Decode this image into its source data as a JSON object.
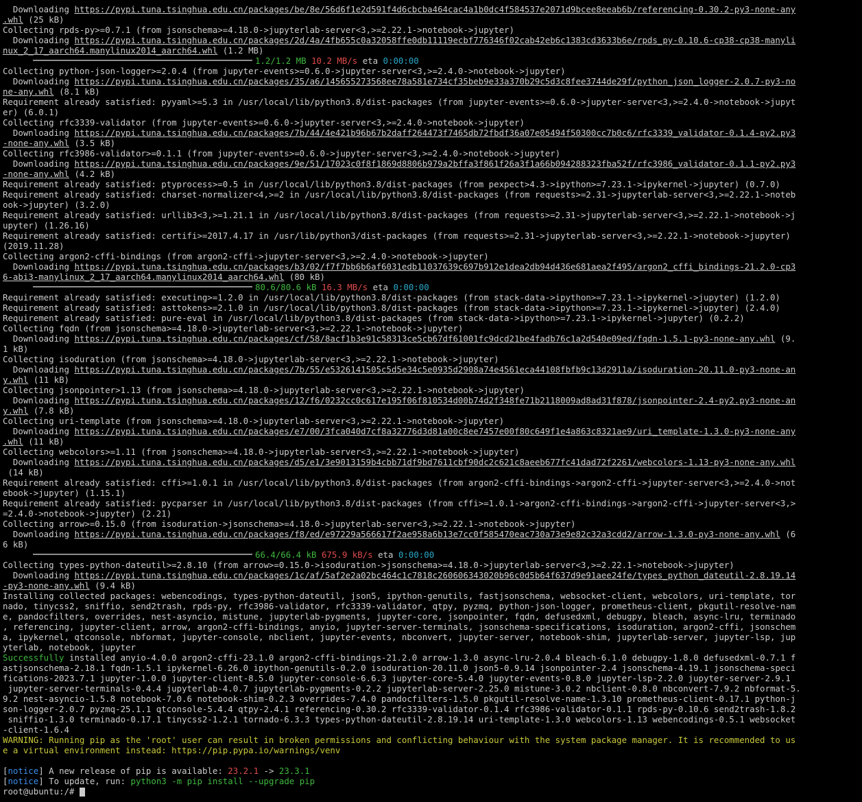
{
  "terminal": {
    "lines": [
      {
        "type": "dl",
        "pre": "  Downloading ",
        "url": "https://pypi.tuna.tsinghua.edu.cn/packages/be/8e/56d6f1e2d591f4d6cbcba464cac4a1b0dc4f584537e2071d9bcee8eeab6b/referencing-0.30.2-py3-none-any",
        "url2": ".whl",
        "post": " (25 kB)"
      },
      {
        "type": "plain",
        "text": "Collecting rpds-py>=0.7.1 (from jsonschema>=4.18.0->jupyterlab-server<3,>=2.22.1->notebook->jupyter)"
      },
      {
        "type": "dl",
        "pre": "  Downloading ",
        "url": "https://pypi.tuna.tsinghua.edu.cn/packages/2d/4a/4fb655c0a32058ffe0db11119ecbf776346f02cab42eb6c1383cd3633b6e/rpds_py-0.10.6-cp38-cp38-manyli",
        "url2": "nux_2_17_aarch64.manylinux2014_aarch64.whl",
        "post": " (1.2 MB)"
      },
      {
        "type": "prog",
        "done": "1.2/1.2 MB",
        "speed": "10.2 MB/s",
        "eta_label": "eta",
        "eta": "0:00:00"
      },
      {
        "type": "plain",
        "text": "Collecting python-json-logger>=2.0.4 (from jupyter-events>=0.6.0->jupyter-server<3,>=2.4.0->notebook->jupyter)"
      },
      {
        "type": "dl",
        "pre": "  Downloading ",
        "url": "https://pypi.tuna.tsinghua.edu.cn/packages/35/a6/145655273568ee78a581e734cf35beb9e33a370b29c5d3c8fee3744de29f/python_json_logger-2.0.7-py3-no",
        "url2": "ne-any.whl",
        "post": " (8.1 kB)"
      },
      {
        "type": "plain",
        "text": "Requirement already satisfied: pyyaml>=5.3 in /usr/local/lib/python3.8/dist-packages (from jupyter-events>=0.6.0->jupyter-server<3,>=2.4.0->notebook->jupyt"
      },
      {
        "type": "plain",
        "text": "er) (6.0.1)"
      },
      {
        "type": "plain",
        "text": "Collecting rfc3339-validator (from jupyter-events>=0.6.0->jupyter-server<3,>=2.4.0->notebook->jupyter)"
      },
      {
        "type": "dl",
        "pre": "  Downloading ",
        "url": "https://pypi.tuna.tsinghua.edu.cn/packages/7b/44/4e421b96b67b2daff264473f7465db72fbdf36a07e05494f50300cc7b0c6/rfc3339_validator-0.1.4-py2.py3",
        "url2": "-none-any.whl",
        "post": " (3.5 kB)"
      },
      {
        "type": "plain",
        "text": "Collecting rfc3986-validator>=0.1.1 (from jupyter-events>=0.6.0->jupyter-server<3,>=2.4.0->notebook->jupyter)"
      },
      {
        "type": "dl",
        "pre": "  Downloading ",
        "url": "https://pypi.tuna.tsinghua.edu.cn/packages/9e/51/17023c0f8f1869d8806b979a2bffa3f861f26a3f1a66b094288323fba52f/rfc3986_validator-0.1.1-py2.py3",
        "url2": "-none-any.whl",
        "post": " (4.2 kB)"
      },
      {
        "type": "plain",
        "text": "Requirement already satisfied: ptyprocess>=0.5 in /usr/local/lib/python3.8/dist-packages (from pexpect>4.3->ipython>=7.23.1->ipykernel->jupyter) (0.7.0)"
      },
      {
        "type": "plain",
        "text": "Requirement already satisfied: charset-normalizer<4,>=2 in /usr/local/lib/python3.8/dist-packages (from requests>=2.31->jupyterlab-server<3,>=2.22.1->noteb"
      },
      {
        "type": "plain",
        "text": "ook->jupyter) (3.2.0)"
      },
      {
        "type": "plain",
        "text": "Requirement already satisfied: urllib3<3,>=1.21.1 in /usr/local/lib/python3.8/dist-packages (from requests>=2.31->jupyterlab-server<3,>=2.22.1->notebook->j"
      },
      {
        "type": "plain",
        "text": "upyter) (1.26.16)"
      },
      {
        "type": "plain",
        "text": "Requirement already satisfied: certifi>=2017.4.17 in /usr/lib/python3/dist-packages (from requests>=2.31->jupyterlab-server<3,>=2.22.1->notebook->jupyter)"
      },
      {
        "type": "plain",
        "text": "(2019.11.28)"
      },
      {
        "type": "plain",
        "text": "Collecting argon2-cffi-bindings (from argon2-cffi->jupyter-server<3,>=2.4.0->notebook->jupyter)"
      },
      {
        "type": "dl",
        "pre": "  Downloading ",
        "url": "https://pypi.tuna.tsinghua.edu.cn/packages/b3/02/f7f7bb6b6af6031edb11037639c697b912e1dea2db94d436e681aea2f495/argon2_cffi_bindings-21.2.0-cp3",
        "url2": "6-abi3-manylinux_2_17_aarch64.manylinux2014_aarch64.whl",
        "post": " (80 kB)"
      },
      {
        "type": "prog",
        "done": "80.6/80.6 kB",
        "speed": "16.3 MB/s",
        "eta_label": "eta",
        "eta": "0:00:00"
      },
      {
        "type": "plain",
        "text": "Requirement already satisfied: executing>=1.2.0 in /usr/local/lib/python3.8/dist-packages (from stack-data->ipython>=7.23.1->ipykernel->jupyter) (1.2.0)"
      },
      {
        "type": "plain",
        "text": "Requirement already satisfied: asttokens>=2.1.0 in /usr/local/lib/python3.8/dist-packages (from stack-data->ipython>=7.23.1->ipykernel->jupyter) (2.4.0)"
      },
      {
        "type": "plain",
        "text": "Requirement already satisfied: pure-eval in /usr/local/lib/python3.8/dist-packages (from stack-data->ipython>=7.23.1->ipykernel->jupyter) (0.2.2)"
      },
      {
        "type": "plain",
        "text": "Collecting fqdn (from jsonschema>=4.18.0->jupyterlab-server<3,>=2.22.1->notebook->jupyter)"
      },
      {
        "type": "dl",
        "pre": "  Downloading ",
        "url": "https://pypi.tuna.tsinghua.edu.cn/packages/cf/58/8acf1b3e91c58313ce5cb67df61001fc9dcd21be4fadb76c1a2d540e09ed/fqdn-1.5.1-py3-none-any.whl",
        "url2": "",
        "post": " (9."
      },
      {
        "type": "plain",
        "text": "1 kB)"
      },
      {
        "type": "plain",
        "text": "Collecting isoduration (from jsonschema>=4.18.0->jupyterlab-server<3,>=2.22.1->notebook->jupyter)"
      },
      {
        "type": "dl",
        "pre": "  Downloading ",
        "url": "https://pypi.tuna.tsinghua.edu.cn/packages/7b/55/e5326141505c5d5e34c5e0935d2908a74e4561eca44108fbfb9c13d2911a/isoduration-20.11.0-py3-none-an",
        "url2": "y.whl",
        "post": " (11 kB)"
      },
      {
        "type": "plain",
        "text": "Collecting jsonpointer>1.13 (from jsonschema>=4.18.0->jupyterlab-server<3,>=2.22.1->notebook->jupyter)"
      },
      {
        "type": "dl",
        "pre": "  Downloading ",
        "url": "https://pypi.tuna.tsinghua.edu.cn/packages/12/f6/0232cc0c617e195f06f810534d00b74d2f348fe71b2118009ad8ad31f878/jsonpointer-2.4-py2.py3-none-an",
        "url2": "y.whl",
        "post": " (7.8 kB)"
      },
      {
        "type": "plain",
        "text": "Collecting uri-template (from jsonschema>=4.18.0->jupyterlab-server<3,>=2.22.1->notebook->jupyter)"
      },
      {
        "type": "dl",
        "pre": "  Downloading ",
        "url": "https://pypi.tuna.tsinghua.edu.cn/packages/e7/00/3fca040d7cf8a32776d3d81a00c8ee7457e00f80c649f1e4a863c8321ae9/uri_template-1.3.0-py3-none-any",
        "url2": ".whl",
        "post": " (11 kB)"
      },
      {
        "type": "plain",
        "text": "Collecting webcolors>=1.11 (from jsonschema>=4.18.0->jupyterlab-server<3,>=2.22.1->notebook->jupyter)"
      },
      {
        "type": "dl",
        "pre": "  Downloading ",
        "url": "https://pypi.tuna.tsinghua.edu.cn/packages/d5/e1/3e9013159b4cbb71df9bd7611cbf90dc2c621c8aeeb677fc41dad72f2261/webcolors-1.13-py3-none-any.whl",
        "url2": "",
        "post": ""
      },
      {
        "type": "plain",
        "text": " (14 kB)"
      },
      {
        "type": "plain",
        "text": "Requirement already satisfied: cffi>=1.0.1 in /usr/local/lib/python3.8/dist-packages (from argon2-cffi-bindings->argon2-cffi->jupyter-server<3,>=2.4.0->not"
      },
      {
        "type": "plain",
        "text": "ebook->jupyter) (1.15.1)"
      },
      {
        "type": "plain",
        "text": "Requirement already satisfied: pycparser in /usr/local/lib/python3.8/dist-packages (from cffi>=1.0.1->argon2-cffi-bindings->argon2-cffi->jupyter-server<3,>"
      },
      {
        "type": "plain",
        "text": "=2.4.0->notebook->jupyter) (2.21)"
      },
      {
        "type": "plain",
        "text": "Collecting arrow>=0.15.0 (from isoduration->jsonschema>=4.18.0->jupyterlab-server<3,>=2.22.1->notebook->jupyter)"
      },
      {
        "type": "dl",
        "pre": "  Downloading ",
        "url": "https://pypi.tuna.tsinghua.edu.cn/packages/f8/ed/e97229a566617f2ae958a6b13e7cc0f585470eac730a73e9e82c32a3cdd2/arrow-1.3.0-py3-none-any.whl",
        "url2": "",
        "post": " (6"
      },
      {
        "type": "plain",
        "text": "6 kB)"
      },
      {
        "type": "prog",
        "done": "66.4/66.4 kB",
        "speed": "675.9 kB/s",
        "eta_label": "eta",
        "eta": "0:00:00"
      },
      {
        "type": "plain",
        "text": "Collecting types-python-dateutil>=2.8.10 (from arrow>=0.15.0->isoduration->jsonschema>=4.18.0->jupyterlab-server<3,>=2.22.1->notebook->jupyter)"
      },
      {
        "type": "dl",
        "pre": "  Downloading ",
        "url": "https://pypi.tuna.tsinghua.edu.cn/packages/1c/af/5af2e2a02bc464c1c7818c260606343020b96c0d5b64f637d9e91aee24fe/types_python_dateutil-2.8.19.14",
        "url2": "-py3-none-any.whl",
        "post": " (9.4 kB)"
      },
      {
        "type": "plain",
        "text": "Installing collected packages: webencodings, types-python-dateutil, json5, ipython-genutils, fastjsonschema, websocket-client, webcolors, uri-template, tor"
      },
      {
        "type": "plain",
        "text": "nado, tinycss2, sniffio, send2trash, rpds-py, rfc3986-validator, rfc3339-validator, qtpy, pyzmq, python-json-logger, prometheus-client, pkgutil-resolve-nam"
      },
      {
        "type": "plain",
        "text": "e, pandocfilters, overrides, nest-asyncio, mistune, jupyterlab-pygments, jupyter-core, jsonpointer, fqdn, defusedxml, debugpy, bleach, async-lru, terminado"
      },
      {
        "type": "plain",
        "text": ", referencing, jupyter-client, arrow, argon2-cffi-bindings, anyio, jupyter-server-terminals, jsonschema-specifications, isoduration, argon2-cffi, jsonschem"
      },
      {
        "type": "plain",
        "text": "a, ipykernel, qtconsole, nbformat, jupyter-console, nbclient, jupyter-events, nbconvert, jupyter-server, notebook-shim, jupyterlab-server, jupyter-lsp, jup"
      },
      {
        "type": "plain",
        "text": "yterlab, notebook, jupyter"
      },
      {
        "type": "succ",
        "word": "Successfully",
        "text": " installed anyio-4.0.0 argon2-cffi-23.1.0 argon2-cffi-bindings-21.2.0 arrow-1.3.0 async-lru-2.0.4 bleach-6.1.0 debugpy-1.8.0 defusedxml-0.7.1 f"
      },
      {
        "type": "plain",
        "text": "astjsonschema-2.18.1 fqdn-1.5.1 ipykernel-6.26.0 ipython-genutils-0.2.0 isoduration-20.11.0 json5-0.9.14 jsonpointer-2.4 jsonschema-4.19.1 jsonschema-speci"
      },
      {
        "type": "plain",
        "text": "fications-2023.7.1 jupyter-1.0.0 jupyter-client-8.5.0 jupyter-console-6.6.3 jupyter-core-5.4.0 jupyter-events-0.8.0 jupyter-lsp-2.2.0 jupyter-server-2.9.1"
      },
      {
        "type": "plain",
        "text": " jupyter-server-terminals-0.4.4 jupyterlab-4.0.7 jupyterlab-pygments-0.2.2 jupyterlab-server-2.25.0 mistune-3.0.2 nbclient-0.8.0 nbconvert-7.9.2 nbformat-5."
      },
      {
        "type": "plain",
        "text": "9.2 nest-asyncio-1.5.8 notebook-7.0.6 notebook-shim-0.2.3 overrides-7.4.0 pandocfilters-1.5.0 pkgutil-resolve-name-1.3.10 prometheus-client-0.17.1 python-j"
      },
      {
        "type": "plain",
        "text": "son-logger-2.0.7 pyzmq-25.1.1 qtconsole-5.4.4 qtpy-2.4.1 referencing-0.30.2 rfc3339-validator-0.1.4 rfc3986-validator-0.1.1 rpds-py-0.10.6 send2trash-1.8.2"
      },
      {
        "type": "plain",
        "text": " sniffio-1.3.0 terminado-0.17.1 tinycss2-1.2.1 tornado-6.3.3 types-python-dateutil-2.8.19.14 uri-template-1.3.0 webcolors-1.13 webencodings-0.5.1 websocket"
      },
      {
        "type": "plain",
        "text": "-client-1.6.4"
      },
      {
        "type": "warn",
        "text": "WARNING: Running pip as the 'root' user can result in broken permissions and conflicting behaviour with the system package manager. It is recommended to us"
      },
      {
        "type": "warn",
        "text": "e a virtual environment instead: https://pip.pypa.io/warnings/venv"
      },
      {
        "type": "blank",
        "text": ""
      },
      {
        "type": "notice1",
        "tag": "notice",
        "text": " A new release of pip is available: ",
        "old": "23.2.1",
        "arrow": " -> ",
        "new": "23.3.1"
      },
      {
        "type": "notice2",
        "tag": "notice",
        "text": " To update, run: ",
        "cmd": "python3 -m pip install --upgrade pip"
      },
      {
        "type": "prompt",
        "text": "root@ubuntu:/# "
      }
    ]
  }
}
